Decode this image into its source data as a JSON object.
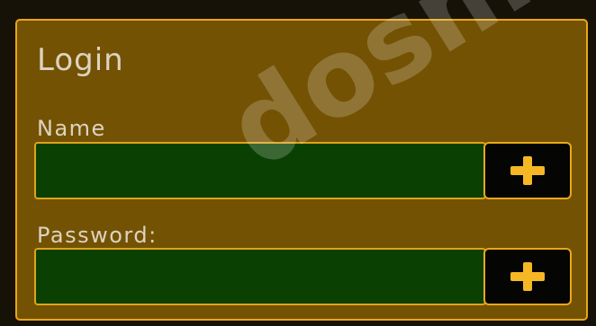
{
  "login": {
    "title": "Login",
    "name_label": "Name",
    "name_value": "",
    "password_label": "Password:",
    "password_value": ""
  },
  "icons": {
    "add_name": "plus-icon",
    "add_password": "plus-icon"
  },
  "watermark": "dosmen",
  "colors": {
    "panel": "#735203",
    "border": "#e9a616",
    "input": "#0a4103",
    "button": "#050504",
    "icon": "#f6b724",
    "text": "#ddd3bf"
  }
}
